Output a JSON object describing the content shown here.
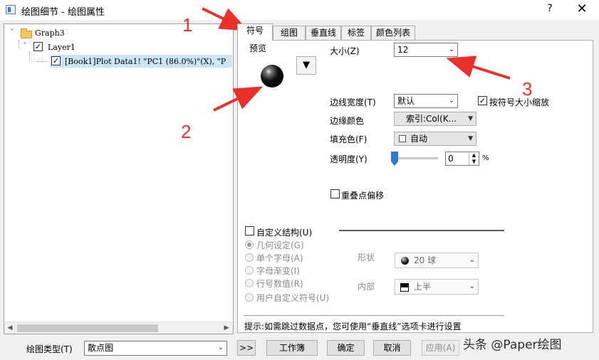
{
  "window": {
    "title": "绘图细节 - 绘图属性",
    "help": "?",
    "close": "✕"
  },
  "tree": {
    "graph": "Graph3",
    "layer": "Layer1",
    "plot": "[Book1]Plot Data1! \"PC1 (86.0%)\"(X), \"P"
  },
  "tabs": [
    {
      "label": "符号",
      "active": true
    },
    {
      "label": "组图",
      "active": false
    },
    {
      "label": "垂直线",
      "active": false
    },
    {
      "label": "标签",
      "active": false
    },
    {
      "label": "颜色列表",
      "active": false
    }
  ],
  "preview": {
    "label": "预览"
  },
  "symbol": {
    "size_label": "大小(Z)",
    "size_value": "12",
    "edge_width_label": "边线宽度(T)",
    "edge_width_value": "默认",
    "scale_label": "按符号大小缩放",
    "scale_checked": true,
    "edge_color_label": "边缘颜色",
    "edge_color_value": "索引:Col(K...",
    "fill_color_label": "填充色(F)",
    "fill_color_value": "自动",
    "transparency_label": "透明度(Y)",
    "transparency_value": "0",
    "transparency_unit": "%",
    "overlap_label": "重叠点偏移",
    "overlap_checked": false
  },
  "custom": {
    "construct_label": "自定义结构(U)",
    "options": [
      {
        "label": "几何设定(G)",
        "selected": true
      },
      {
        "label": "单个字母(A)",
        "selected": false
      },
      {
        "label": "字母渐变(I)",
        "selected": false
      },
      {
        "label": "行号数值(R)",
        "selected": false
      },
      {
        "label": "用户自定义符号(U)",
        "selected": false
      }
    ],
    "shape_label": "形状",
    "shape_value": "20 球",
    "interior_label": "内部",
    "interior_value": "上半"
  },
  "hint": "提示:如需跳过数据点，您可使用“垂直线”选项卡进行设置",
  "footer": {
    "plot_type_label": "绘图类型(T)",
    "plot_type_value": "散点图",
    "expand": ">>",
    "workbook": "工作簿",
    "ok": "确定",
    "cancel": "取消",
    "apply": "应用(A)"
  },
  "annotations": [
    "1",
    "2",
    "3"
  ],
  "watermark": "头条 @Paper绘图",
  "colors": {
    "annotation_red": "#e8312a",
    "selection_blue": "#cce4f7",
    "slider_blue": "#2d7ad6"
  }
}
